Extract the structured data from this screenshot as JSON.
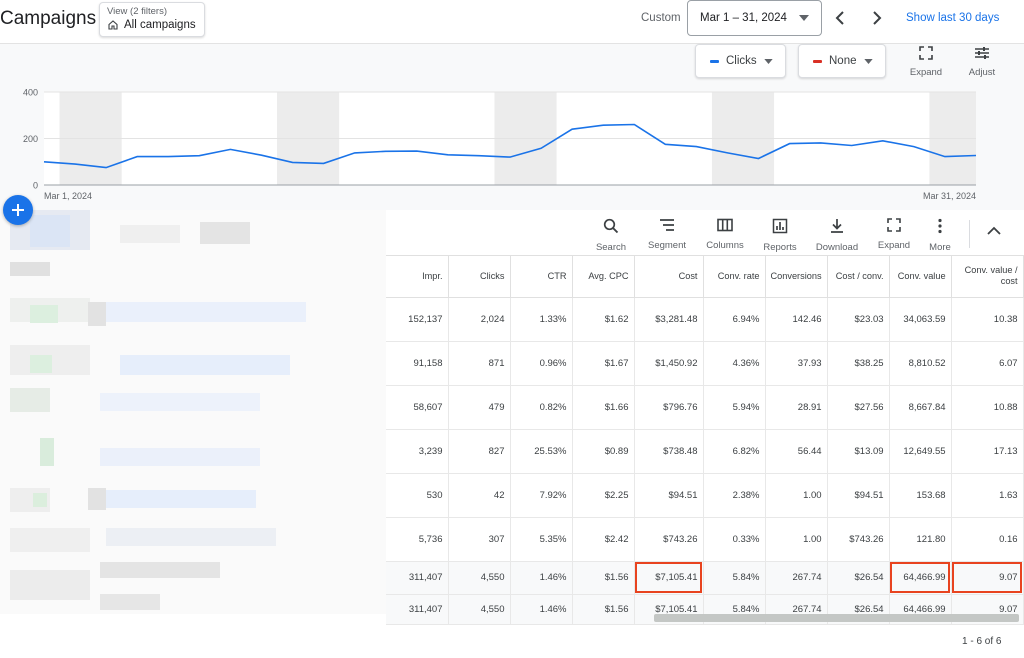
{
  "header": {
    "title": "Campaigns",
    "view_filter_label": "View (2 filters)",
    "view_value": "All campaigns",
    "date_mode": "Custom",
    "date_range": "Mar 1 – 31, 2024",
    "show_last": "Show last 30 days"
  },
  "chart_controls": {
    "metric1": "Clicks",
    "metric1_color": "#1a73e8",
    "metric2": "None",
    "metric2_color": "#d93025",
    "expand_label": "Expand",
    "adjust_label": "Adjust"
  },
  "chart_data": {
    "type": "line",
    "ylim": [
      0,
      400
    ],
    "yticks": [
      "400",
      "200",
      "0"
    ],
    "x_start_label": "Mar 1, 2024",
    "x_end_label": "Mar 31, 2024",
    "weekend_bands": [
      [
        2,
        3
      ],
      [
        9,
        10
      ],
      [
        16,
        17
      ],
      [
        23,
        24
      ],
      [
        30,
        31
      ]
    ],
    "series": [
      {
        "color": "#1a73e8",
        "values": [
          100,
          90,
          75,
          122,
          122,
          126,
          153,
          128,
          97,
          93,
          138,
          145,
          146,
          130,
          126,
          120,
          158,
          240,
          257,
          260,
          175,
          165,
          138,
          114,
          178,
          181,
          170,
          190,
          165,
          122,
          127
        ]
      }
    ]
  },
  "toolbar": {
    "search": "Search",
    "segment": "Segment",
    "columns": "Columns",
    "reports": "Reports",
    "download": "Download",
    "expand": "Expand",
    "more": "More"
  },
  "table": {
    "headers": [
      "Impr.",
      "Clicks",
      "CTR",
      "Avg. CPC",
      "Cost",
      "Conv. rate",
      "Conversions",
      "Cost / conv.",
      "Conv. value",
      "Conv. value / cost"
    ],
    "rows": [
      [
        "152,137",
        "2,024",
        "1.33%",
        "$1.62",
        "$3,281.48",
        "6.94%",
        "142.46",
        "$23.03",
        "34,063.59",
        "10.38"
      ],
      [
        "91,158",
        "871",
        "0.96%",
        "$1.67",
        "$1,450.92",
        "4.36%",
        "37.93",
        "$38.25",
        "8,810.52",
        "6.07"
      ],
      [
        "58,607",
        "479",
        "0.82%",
        "$1.66",
        "$796.76",
        "5.94%",
        "28.91",
        "$27.56",
        "8,667.84",
        "10.88"
      ],
      [
        "3,239",
        "827",
        "25.53%",
        "$0.89",
        "$738.48",
        "6.82%",
        "56.44",
        "$13.09",
        "12,649.55",
        "17.13"
      ],
      [
        "530",
        "42",
        "7.92%",
        "$2.25",
        "$94.51",
        "2.38%",
        "1.00",
        "$94.51",
        "153.68",
        "1.63"
      ],
      [
        "5,736",
        "307",
        "5.35%",
        "$2.42",
        "$743.26",
        "0.33%",
        "1.00",
        "$743.26",
        "121.80",
        "0.16"
      ]
    ],
    "totals": [
      [
        "311,407",
        "4,550",
        "1.46%",
        "$1.56",
        "$7,105.41",
        "5.84%",
        "267.74",
        "$26.54",
        "64,466.99",
        "9.07"
      ],
      [
        "311,407",
        "4,550",
        "1.46%",
        "$1.56",
        "$7,105.41",
        "5.84%",
        "267.74",
        "$26.54",
        "64,466.99",
        "9.07"
      ]
    ],
    "highlight_color": "#e8431f"
  },
  "pager": {
    "text": "1 - 6 of 6"
  }
}
